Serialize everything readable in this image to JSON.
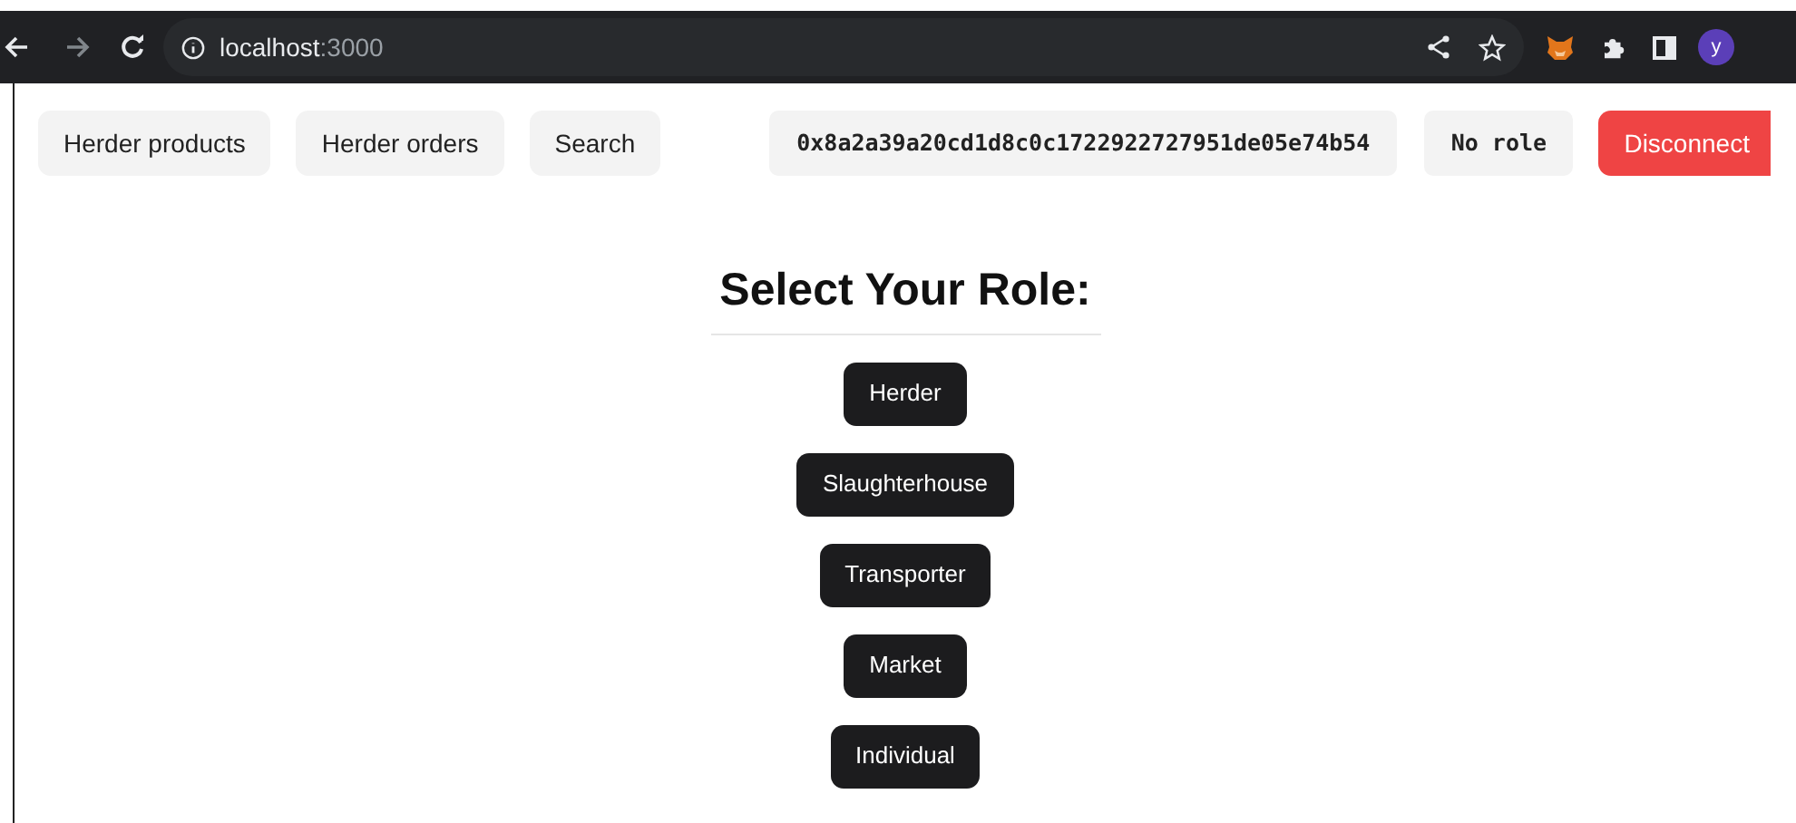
{
  "browser": {
    "url_host": "localhost",
    "url_port": ":3000",
    "avatar": "y"
  },
  "nav": {
    "links": [
      "Herder products",
      "Herder orders",
      "Search"
    ],
    "address": "0x8a2a39a20cd1d8c0c1722922727951de05e74b54",
    "role": "No role",
    "disconnect": "Disconnect"
  },
  "heading": "Select Your Role:",
  "roles": [
    "Herder",
    "Slaughterhouse",
    "Transporter",
    "Market",
    "Individual"
  ]
}
